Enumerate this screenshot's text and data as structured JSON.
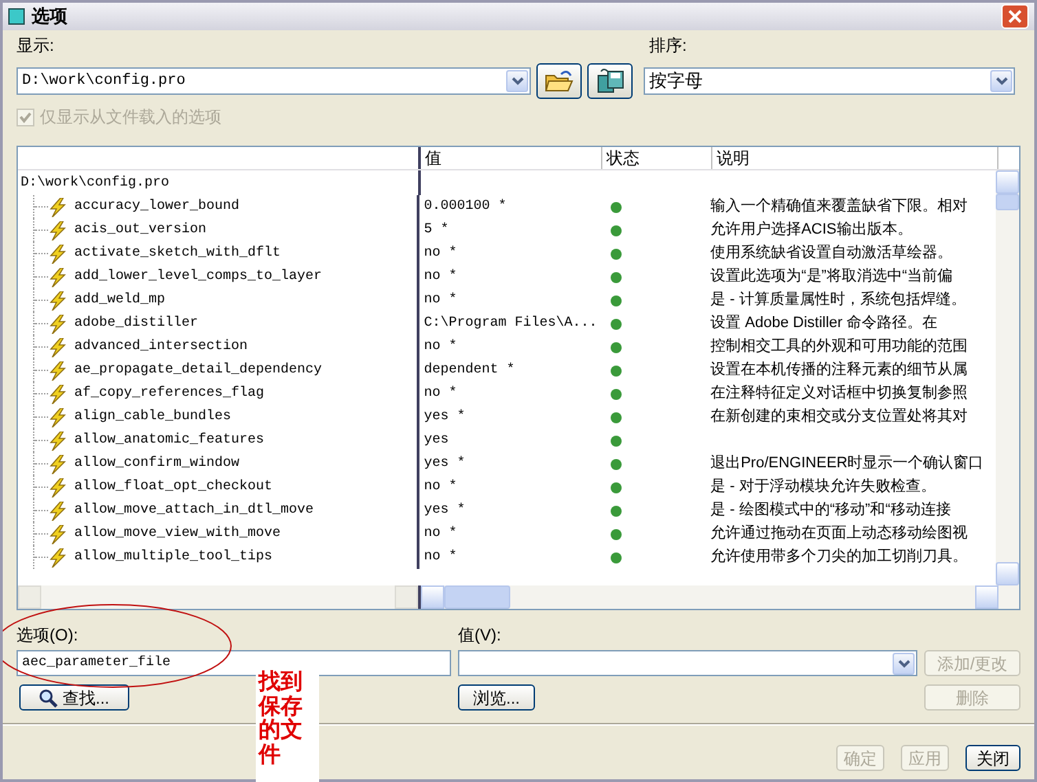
{
  "window": {
    "title": "选项"
  },
  "display": {
    "label": "显示:",
    "value": "D:\\work\\config.pro"
  },
  "sort": {
    "label": "排序:",
    "value": "按字母"
  },
  "loaded_only": {
    "label": "仅显示从文件载入的选项",
    "checked": true,
    "disabled": true
  },
  "table": {
    "columns": [
      "值",
      "状态",
      "说明"
    ],
    "root": "D:\\work\\config.pro",
    "rows": [
      {
        "name": "accuracy_lower_bound",
        "value": "0.000100 *",
        "description": "输入一个精确值来覆盖缺省下限。相对"
      },
      {
        "name": "acis_out_version",
        "value": "5 *",
        "description": "允许用户选择ACIS输出版本。"
      },
      {
        "name": "activate_sketch_with_dflt",
        "value": "no *",
        "description": "使用系统缺省设置自动激活草绘器。"
      },
      {
        "name": "add_lower_level_comps_to_layer",
        "value": "no *",
        "description": "设置此选项为“是”将取消选中“当前偏"
      },
      {
        "name": "add_weld_mp",
        "value": "no *",
        "description": "是 - 计算质量属性时，系统包括焊缝。"
      },
      {
        "name": "adobe_distiller",
        "value": "C:\\Program Files\\A...",
        "description": "设置 Adobe Distiller 命令路径。在"
      },
      {
        "name": "advanced_intersection",
        "value": "no *",
        "description": "控制相交工具的外观和可用功能的范围"
      },
      {
        "name": "ae_propagate_detail_dependency",
        "value": "dependent *",
        "description": "设置在本机传播的注释元素的细节从属"
      },
      {
        "name": "af_copy_references_flag",
        "value": "no *",
        "description": "在注释特征定义对话框中切换复制参照"
      },
      {
        "name": "align_cable_bundles",
        "value": "yes *",
        "description": "在新创建的束相交或分支位置处将其对"
      },
      {
        "name": "allow_anatomic_features",
        "value": "yes"
      },
      {
        "name": "allow_confirm_window",
        "value": "yes *",
        "description": "退出Pro/ENGINEER时显示一个确认窗口"
      },
      {
        "name": "allow_float_opt_checkout",
        "value": "no *",
        "description": "是 - 对于浮动模块允许失败检查。"
      },
      {
        "name": "allow_move_attach_in_dtl_move",
        "value": "yes *",
        "description": "是 - 绘图模式中的“移动”和“移动连接"
      },
      {
        "name": "allow_move_view_with_move",
        "value": "no *",
        "description": "允许通过拖动在页面上动态移动绘图视"
      },
      {
        "name": "allow_multiple_tool_tips",
        "value": "no *",
        "description": "允许使用带多个刀尖的加工切削刀具。"
      }
    ]
  },
  "option": {
    "label": "选项(O):",
    "value": "aec_parameter_file"
  },
  "value_field": {
    "label": "值(V):"
  },
  "buttons": [
    {
      "label": "添加/更改",
      "disabled": true
    },
    {
      "label": "查找...",
      "disabled": false
    },
    {
      "label": "浏览...",
      "disabled": false
    },
    {
      "label": "删除",
      "disabled": true
    },
    {
      "label": "确定",
      "disabled": true
    },
    {
      "label": "应用",
      "disabled": true
    },
    {
      "label": "关闭",
      "disabled": false
    }
  ],
  "annotation": {
    "text": "找到保存的文件"
  }
}
